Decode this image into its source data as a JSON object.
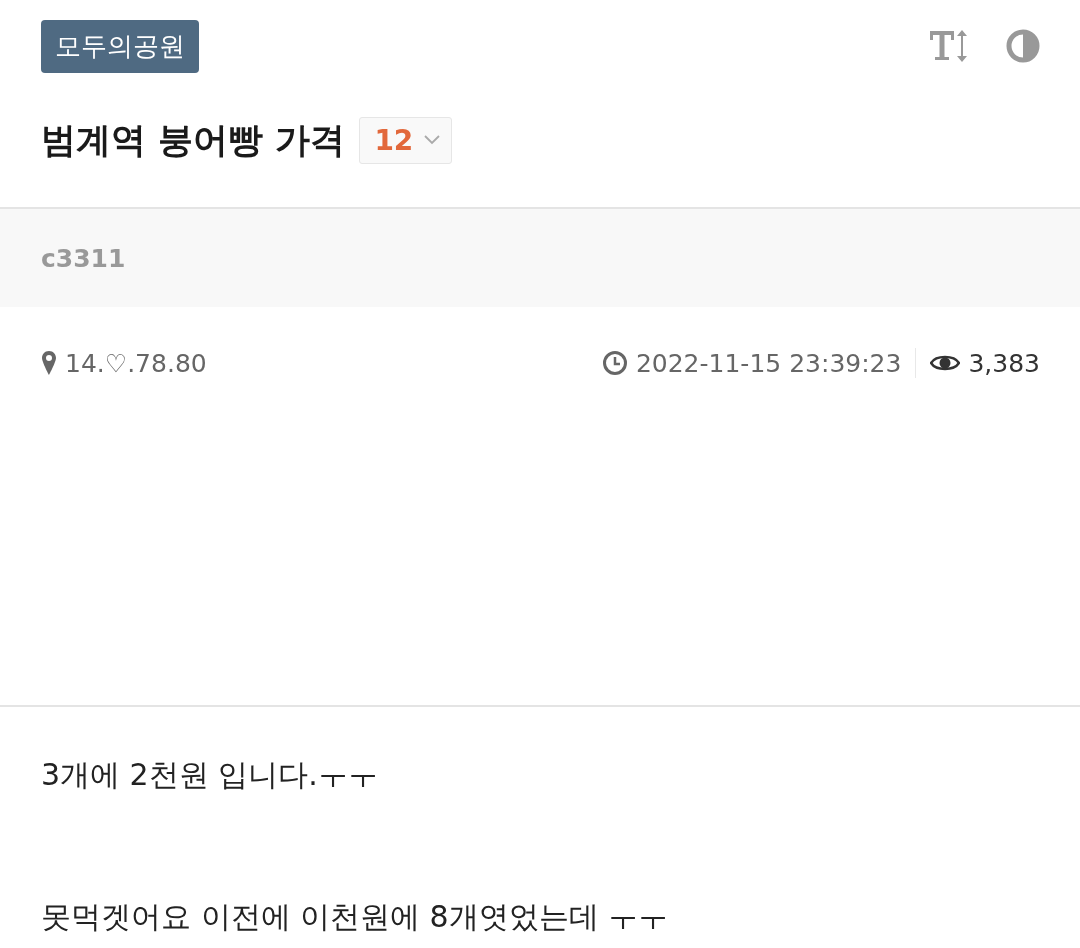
{
  "board": "모두의공원",
  "title": "범계역 붕어빵 가격",
  "comment_count": "12",
  "author": "c3311",
  "meta": {
    "ip": "14.♡.78.80",
    "datetime": "2022-11-15 23:39:23",
    "views": "3,383"
  },
  "body": [
    "3개에 2천원 입니다.ㅜㅜ",
    "못먹겟어요 이전에 이천원에 8개엿었는데 ㅜㅜ"
  ]
}
